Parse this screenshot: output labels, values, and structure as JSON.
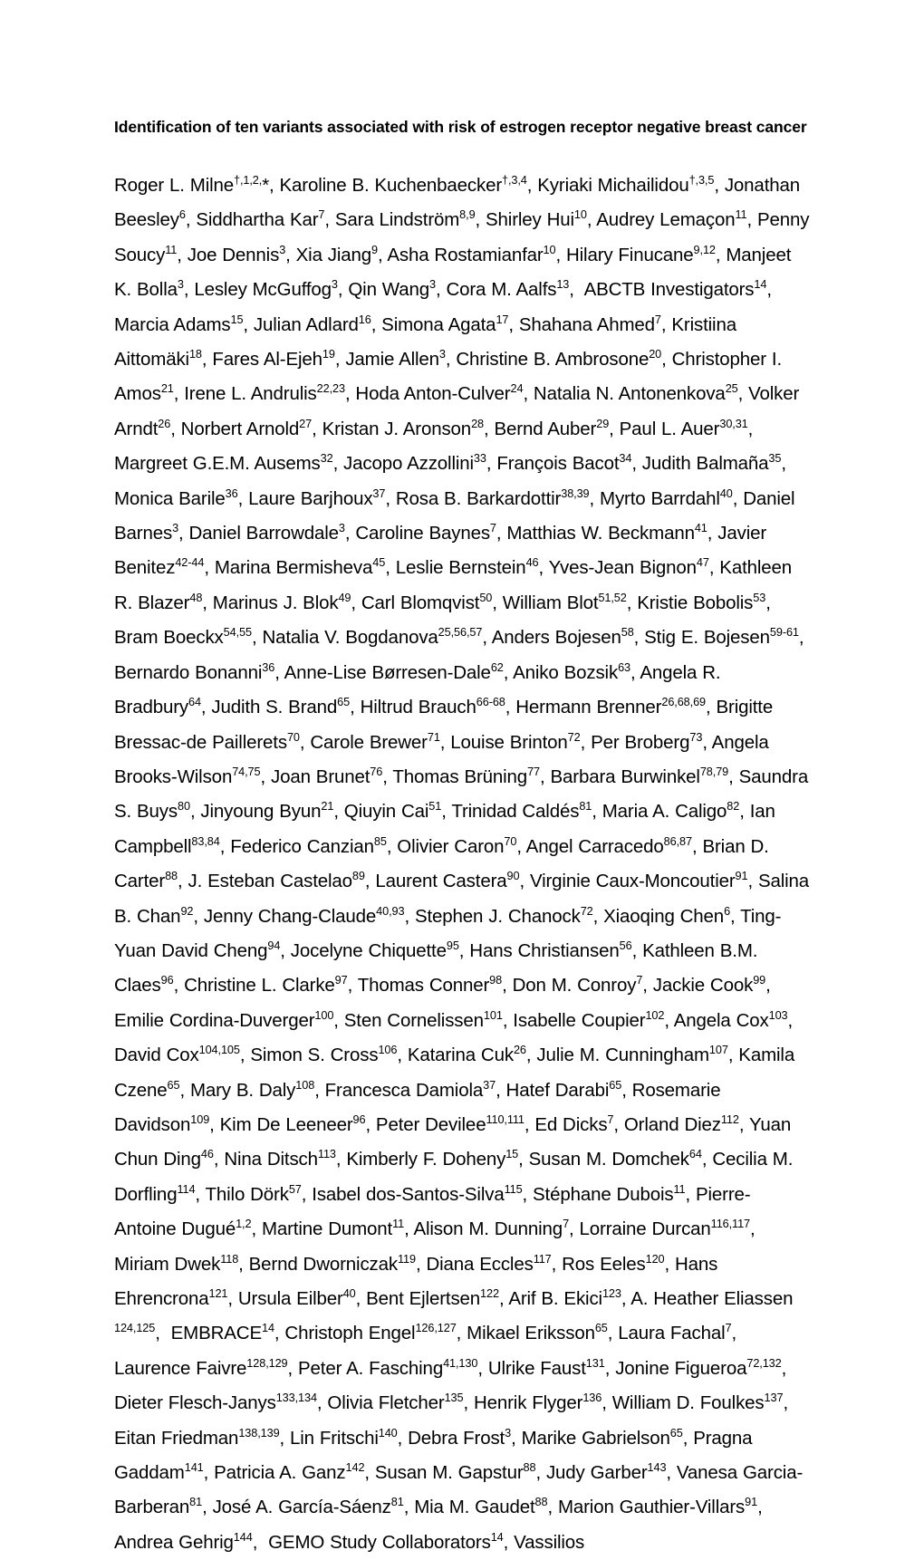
{
  "document": {
    "title": "Identification of ten variants associated with risk of estrogen receptor negative breast cancer",
    "authors_html": "Roger L. Milne<sup>†,1,2,</sup>*, Karoline B. Kuchenbaecker<sup>†,3,4</sup>, Kyriaki Michailidou<sup>†,3,5</sup>, Jonathan Beesley<sup>6</sup>, Siddhartha Kar<sup>7</sup>, Sara Lindström<sup>8,9</sup>, Shirley Hui<sup>10</sup>, Audrey Lemaçon<sup>11</sup>, Penny Soucy<sup>11</sup>, Joe Dennis<sup>3</sup>, Xia Jiang<sup>9</sup>, Asha Rostamianfar<sup>10</sup>, Hilary Finucane<sup>9,12</sup>, Manjeet K. Bolla<sup>3</sup>, Lesley McGuffog<sup>3</sup>, Qin Wang<sup>3</sup>, Cora M. Aalfs<sup>13</sup>,&nbsp; ABCTB Investigators<sup>14</sup>, Marcia Adams<sup>15</sup>, Julian Adlard<sup>16</sup>, Simona Agata<sup>17</sup>, Shahana Ahmed<sup>7</sup>, Kristiina Aittomäki<sup>18</sup>, Fares Al-Ejeh<sup>19</sup>, Jamie Allen<sup>3</sup>, Christine B. Ambrosone<sup>20</sup>, Christopher I. Amos<sup>21</sup>, Irene L. Andrulis<sup>22,23</sup>, Hoda Anton-Culver<sup>24</sup>, Natalia N. Antonenkova<sup>25</sup>, Volker Arndt<sup>26</sup>, Norbert Arnold<sup>27</sup>, Kristan J. Aronson<sup>28</sup>, Bernd Auber<sup>29</sup>, Paul L. Auer<sup>30,31</sup>, Margreet G.E.M. Ausems<sup>32</sup>, Jacopo Azzollini<sup>33</sup>, François Bacot<sup>34</sup>, Judith Balmaña<sup>35</sup>, Monica Barile<sup>36</sup>, Laure Barjhoux<sup>37</sup>, Rosa B. Barkardottir<sup>38,39</sup>, Myrto Barrdahl<sup>40</sup>, Daniel Barnes<sup>3</sup>, Daniel Barrowdale<sup>3</sup>, Caroline Baynes<sup>7</sup>, Matthias W. Beckmann<sup>41</sup>, Javier Benitez<sup>42-44</sup>, Marina Bermisheva<sup>45</sup>, Leslie Bernstein<sup>46</sup>, Yves-Jean Bignon<sup>47</sup>, Kathleen R. Blazer<sup>48</sup>, Marinus J. Blok<sup>49</sup>, Carl Blomqvist<sup>50</sup>, William Blot<sup>51,52</sup>, Kristie Bobolis<sup>53</sup>, Bram Boeckx<sup>54,55</sup>, Natalia V. Bogdanova<sup>25,56,57</sup>, Anders Bojesen<sup>58</sup>, Stig E. Bojesen<sup>59-61</sup>, Bernardo Bonanni<sup>36</sup>, Anne-Lise Børresen-Dale<sup>62</sup>, Aniko Bozsik<sup>63</sup>, Angela R. Bradbury<sup>64</sup>, Judith S. Brand<sup>65</sup>, Hiltrud Brauch<sup>66-68</sup>, Hermann Brenner<sup>26,68,69</sup>, Brigitte Bressac-de Paillerets<sup>70</sup>, Carole Brewer<sup>71</sup>, Louise Brinton<sup>72</sup>, Per Broberg<sup>73</sup>, Angela Brooks-Wilson<sup>74,75</sup>, Joan Brunet<sup>76</sup>, Thomas Brüning<sup>77</sup>, Barbara Burwinkel<sup>78,79</sup>, Saundra S. Buys<sup>80</sup>, Jinyoung Byun<sup>21</sup>, Qiuyin Cai<sup>51</sup>, Trinidad Caldés<sup>81</sup>, Maria A. Caligo<sup>82</sup>, Ian Campbell<sup>83,84</sup>, Federico Canzian<sup>85</sup>, Olivier Caron<sup>70</sup>, Angel Carracedo<sup>86,87</sup>, Brian D. Carter<sup>88</sup>, J. Esteban Castelao<sup>89</sup>, Laurent Castera<sup>90</sup>, Virginie Caux-Moncoutier<sup>91</sup>, Salina B. Chan<sup>92</sup>, Jenny Chang-Claude<sup>40,93</sup>, Stephen J. Chanock<sup>72</sup>, Xiaoqing Chen<sup>6</sup>, Ting-Yuan David Cheng<sup>94</sup>, Jocelyne Chiquette<sup>95</sup>, Hans Christiansen<sup>56</sup>, Kathleen B.M. Claes<sup>96</sup>, Christine L. Clarke<sup>97</sup>, Thomas Conner<sup>98</sup>, Don M. Conroy<sup>7</sup>, Jackie Cook<sup>99</sup>, Emilie Cordina-Duverger<sup>100</sup>, Sten Cornelissen<sup>101</sup>, Isabelle Coupier<sup>102</sup>, Angela Cox<sup>103</sup>, David Cox<sup>104,105</sup>, Simon S. Cross<sup>106</sup>, Katarina Cuk<sup>26</sup>, Julie M. Cunningham<sup>107</sup>, Kamila Czene<sup>65</sup>, Mary B. Daly<sup>108</sup>, Francesca Damiola<sup>37</sup>, Hatef Darabi<sup>65</sup>, Rosemarie Davidson<sup>109</sup>, Kim De Leeneer<sup>96</sup>, Peter Devilee<sup>110,111</sup>, Ed Dicks<sup>7</sup>, Orland Diez<sup>112</sup>, Yuan Chun Ding<sup>46</sup>, Nina Ditsch<sup>113</sup>, Kimberly F. Doheny<sup>15</sup>, Susan M. Domchek<sup>64</sup>, Cecilia M. Dorfling<sup>114</sup>, Thilo Dörk<sup>57</sup>, Isabel dos-Santos-Silva<sup>115</sup>, Stéphane Dubois<sup>11</sup>, Pierre-Antoine Dugué<sup>1,2</sup>, Martine Dumont<sup>11</sup>, Alison M. Dunning<sup>7</sup>, Lorraine Durcan<sup>116,117</sup>, Miriam Dwek<sup>118</sup>, Bernd Dworniczak<sup>119</sup>, Diana Eccles<sup>117</sup>, Ros Eeles<sup>120</sup>, Hans Ehrencrona<sup>121</sup>, Ursula Eilber<sup>40</sup>, Bent Ejlertsen<sup>122</sup>, Arif B. Ekici<sup>123</sup>, A. Heather Eliassen <sup>124,125</sup>,&nbsp; EMBRACE<sup>14</sup>, Christoph Engel<sup>126,127</sup>, Mikael Eriksson<sup>65</sup>, Laura Fachal<sup>7</sup>, Laurence Faivre<sup>128,129</sup>, Peter A. Fasching<sup>41,130</sup>, Ulrike Faust<sup>131</sup>, Jonine Figueroa<sup>72,132</sup>, Dieter Flesch-Janys<sup>133,134</sup>, Olivia Fletcher<sup>135</sup>, Henrik Flyger<sup>136</sup>, William D. Foulkes<sup>137</sup>, Eitan Friedman<sup>138,139</sup>, Lin Fritschi<sup>140</sup>, Debra Frost<sup>3</sup>, Marike Gabrielson<sup>65</sup>, Pragna Gaddam<sup>141</sup>, Patricia A. Ganz<sup>142</sup>, Susan M. Gapstur<sup>88</sup>, Judy Garber<sup>143</sup>, Vanesa Garcia-Barberan<sup>81</sup>, José A. García-Sáenz<sup>81</sup>, Mia M. Gaudet<sup>88</sup>, Marion Gauthier-Villars<sup>91</sup>, Andrea Gehrig<sup>144</sup>,&nbsp; GEMO Study Collaborators<sup>14</sup>, Vassilios"
  }
}
